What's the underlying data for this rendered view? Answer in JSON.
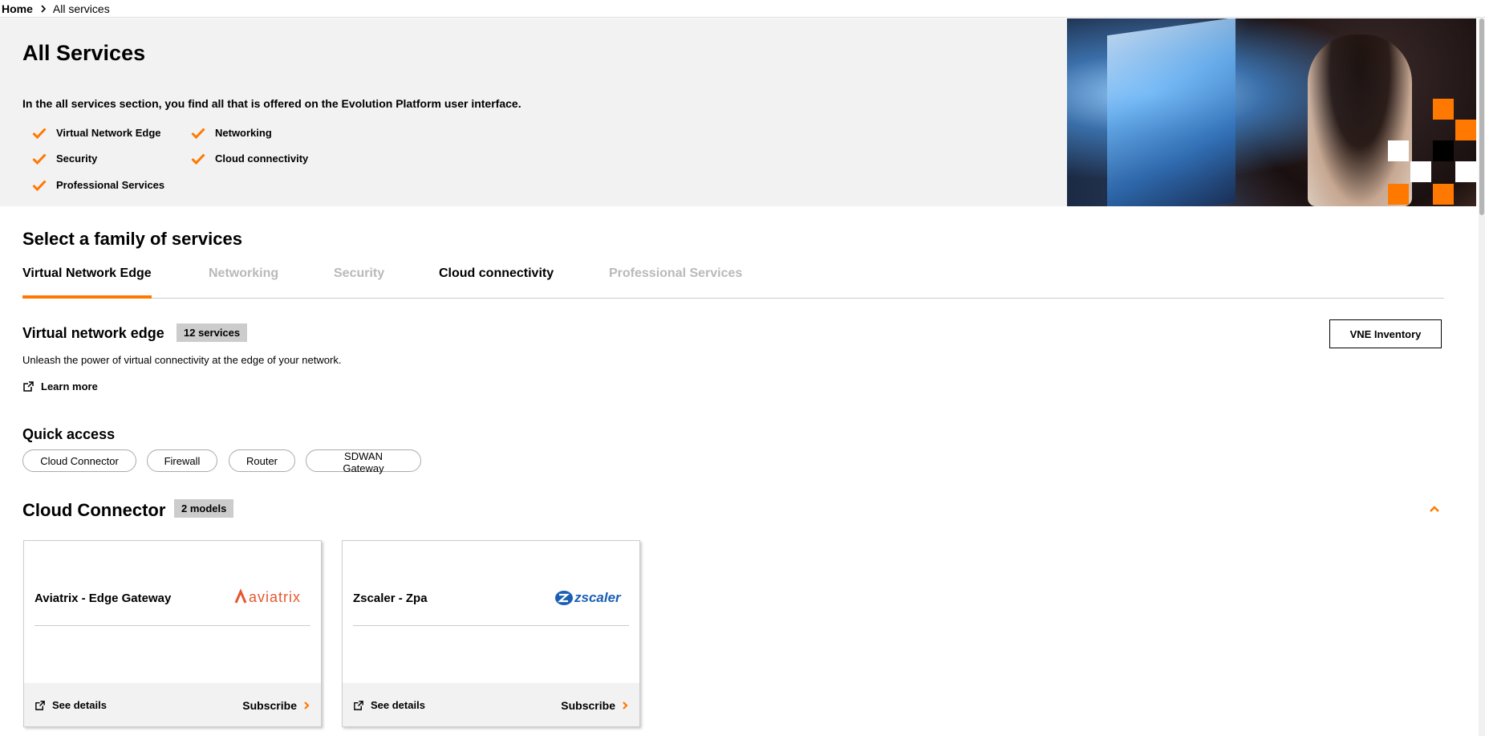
{
  "breadcrumb": {
    "home": "Home",
    "current": "All services"
  },
  "hero": {
    "title": "All Services",
    "intro": "In the all services section, you find all that is offered on the Evolution Platform user interface.",
    "features": [
      "Virtual Network Edge",
      "Networking",
      "Security",
      "Cloud connectivity",
      "Professional Services"
    ]
  },
  "family": {
    "title": "Select a family of services",
    "tabs": [
      {
        "label": "Virtual Network Edge",
        "state": "active"
      },
      {
        "label": "Networking",
        "state": "disabled"
      },
      {
        "label": "Security",
        "state": "disabled"
      },
      {
        "label": "Cloud connectivity",
        "state": "enabled"
      },
      {
        "label": "Professional Services",
        "state": "disabled"
      }
    ]
  },
  "vne": {
    "title": "Virtual network edge",
    "badge": "12 services",
    "description": "Unleash the power of virtual connectivity at the edge of your network.",
    "learn_more": "Learn more",
    "inventory_button": "VNE Inventory"
  },
  "quick_access": {
    "title": "Quick access",
    "items": [
      "Cloud Connector",
      "Firewall",
      "Router",
      "SDWAN Gateway"
    ]
  },
  "cloud_connector": {
    "title": "Cloud Connector",
    "badge": "2 models",
    "cards": [
      {
        "title": "Aviatrix - Edge Gateway",
        "logo_text": "aviatrix",
        "see_details": "See details",
        "subscribe": "Subscribe"
      },
      {
        "title": "Zscaler - Zpa",
        "logo_text": "zscaler",
        "see_details": "See details",
        "subscribe": "Subscribe"
      }
    ]
  },
  "colors": {
    "accent": "#ff7900",
    "hero_bg": "#f2f2f2",
    "badge_bg": "#cccccc",
    "disabled_tab": "#b9b9b9",
    "zscaler_blue": "#1a5fb4"
  }
}
